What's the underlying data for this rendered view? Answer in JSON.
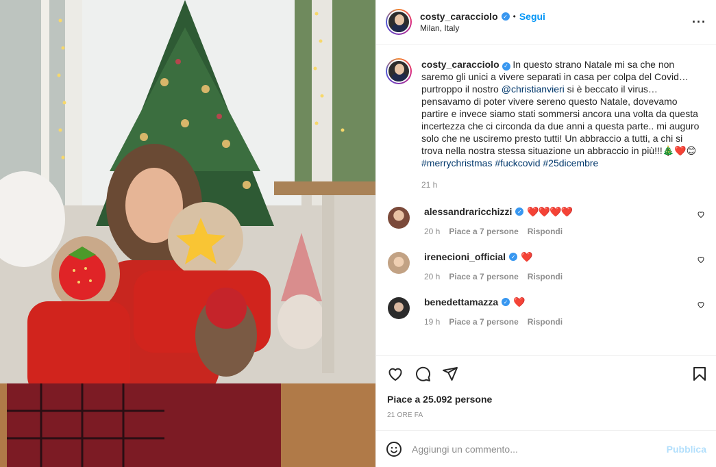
{
  "colors": {
    "link": "#00376b",
    "follow": "#0095f6",
    "verified": "#3897f0",
    "heart": "#ed4956",
    "muted": "#8e8e8e",
    "publish_disabled": "#b2dffc"
  },
  "header": {
    "username": "costy_caracciolo",
    "follow_label": "Segui",
    "location": "Milan, Italy",
    "more_icon": "more-horizontal-icon"
  },
  "caption": {
    "username": "costy_caracciolo",
    "text_before": "In questo strano Natale mi sa che non saremo gli unici a vivere separati in casa per colpa del Covid… purtroppo il nostro ",
    "mention": "@christianvieri",
    "text_after": " si è beccato il virus… pensavamo di poter vivere sereno questo Natale, dovevamo partire e invece siamo stati sommersi ancora una volta da questa incertezza che ci circonda da due anni a questa parte.. mi auguro solo che ne usciremo presto tutti! Un abbraccio a tutti, a chi si trova nella nostra stessa situazione un abbraccio in più!!!🎄❤️😊",
    "hashtags": "#merrychristmas #fuckcovid #25dicembre",
    "time": "21 h"
  },
  "comments": [
    {
      "username": "alessandraricchizzi",
      "text": "❤️❤️❤️❤️",
      "time": "20 h",
      "likes": "Piace a 7 persone",
      "reply": "Rispondi"
    },
    {
      "username": "irenecioni_official",
      "text": "❤️",
      "time": "20 h",
      "likes": "Piace a 7 persone",
      "reply": "Rispondi"
    },
    {
      "username": "benedettamazza",
      "text": "❤️",
      "time": "19 h",
      "likes": "Piace a 7 persone",
      "reply": "Rispondi"
    }
  ],
  "actions": {
    "like_icon": "heart-icon",
    "comment_icon": "comment-icon",
    "share_icon": "share-icon",
    "save_icon": "bookmark-icon"
  },
  "likes_text": "Piace a 25.092 persone",
  "posted": "21 ORE FA",
  "add_comment": {
    "placeholder": "Aggiungi un commento...",
    "publish": "Pubblica",
    "emoji_icon": "emoji-icon"
  }
}
